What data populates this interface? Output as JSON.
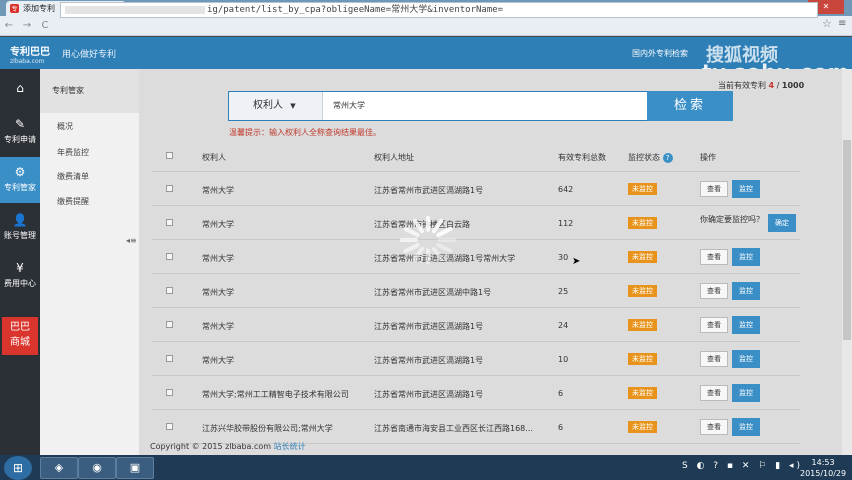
{
  "browser": {
    "tab_title": "添加专利",
    "tab_close": "×",
    "address_visible": "ig/patent/list_by_cpa?obligeeName=常州大学&inventorName=",
    "back": "←",
    "forward": "→",
    "reload": "C",
    "star": "☆",
    "menu": "≡",
    "minimize": "—",
    "maximize": "□",
    "close": "✕"
  },
  "header": {
    "brand_name": "专利巴巴",
    "brand_domain": "zlbaba.com",
    "slogan": "用心做好专利",
    "link": "国内外专利检索",
    "watermark_top": "搜狐视频",
    "watermark": "tv.sohu.com"
  },
  "leftnav": {
    "home": "⌂",
    "items": [
      {
        "icon": "✎",
        "label": "专利申请"
      },
      {
        "icon": "⚙",
        "label": "专利管家"
      },
      {
        "icon": "👤",
        "label": "账号管理"
      },
      {
        "icon": "¥",
        "label": "费用中心"
      }
    ],
    "shop_line1": "巴巴",
    "shop_line2": "商城"
  },
  "submenu": {
    "title": "专利管家",
    "items": [
      "概况",
      "年费监控",
      "缴费清单",
      "缴费提醒"
    ],
    "collapse": "◂≡"
  },
  "stat": {
    "label": "当前有效专利",
    "current": "4",
    "sep": "/",
    "total": "1000"
  },
  "search": {
    "select_label": "权利人",
    "select_arrow": "▼",
    "value": "常州大学",
    "button": "检索",
    "tip": "温馨提示：输入权利人全称查询结果最佳。"
  },
  "table": {
    "headers": {
      "holder": "权利人",
      "address": "权利人地址",
      "count": "有效专利总数",
      "status": "监控状态",
      "help": "?",
      "ops": "操作"
    },
    "view_label": "查看",
    "monitor_label": "监控",
    "status_label": "未监控",
    "confirm_text": "你确定要监控吗？",
    "confirm_ok": "确定",
    "rows": [
      {
        "holder": "常州大学",
        "address": "江苏省常州市武进区滆湖路1号",
        "count": "642"
      },
      {
        "holder": "常州大学",
        "address": "江苏省常州市钟楼区白云路",
        "count": "112"
      },
      {
        "holder": "常州大学",
        "address": "江苏省常州市武进区滆湖路1号常州大学",
        "count": "30"
      },
      {
        "holder": "常州大学",
        "address": "江苏省常州市武进区滆湖中路1号",
        "count": "25"
      },
      {
        "holder": "常州大学",
        "address": "江苏省常州市武进区滆湖路1号",
        "count": "24"
      },
      {
        "holder": "常州大学",
        "address": "江苏省常州市武进区滆湖路1号",
        "count": "10"
      },
      {
        "holder": "常州大学;常州工工精智电子技术有限公司",
        "address": "江苏省常州市武进区滆湖路1号",
        "count": "6"
      },
      {
        "holder": "江苏兴华胶带股份有限公司;常州大学",
        "address": "江苏省南通市海安县工业西区长江西路168...",
        "count": "6"
      }
    ]
  },
  "footer": {
    "text": "Copyright © 2015 zlbaba.com",
    "link": "站长统计"
  },
  "taskbar": {
    "start": "⊞",
    "apps": [
      "◈",
      "◉",
      "▣"
    ],
    "tray": "S ◐ ? ▪ ✕ ⚐ ▮ ◂)",
    "time": "14:53",
    "date": "2015/10/29"
  },
  "colors": {
    "primary": "#2f7fb7",
    "accent_button": "#3a8fc7",
    "status_badge": "#e8941c",
    "tip_text": "#c0392b",
    "shop": "#d9352d"
  }
}
